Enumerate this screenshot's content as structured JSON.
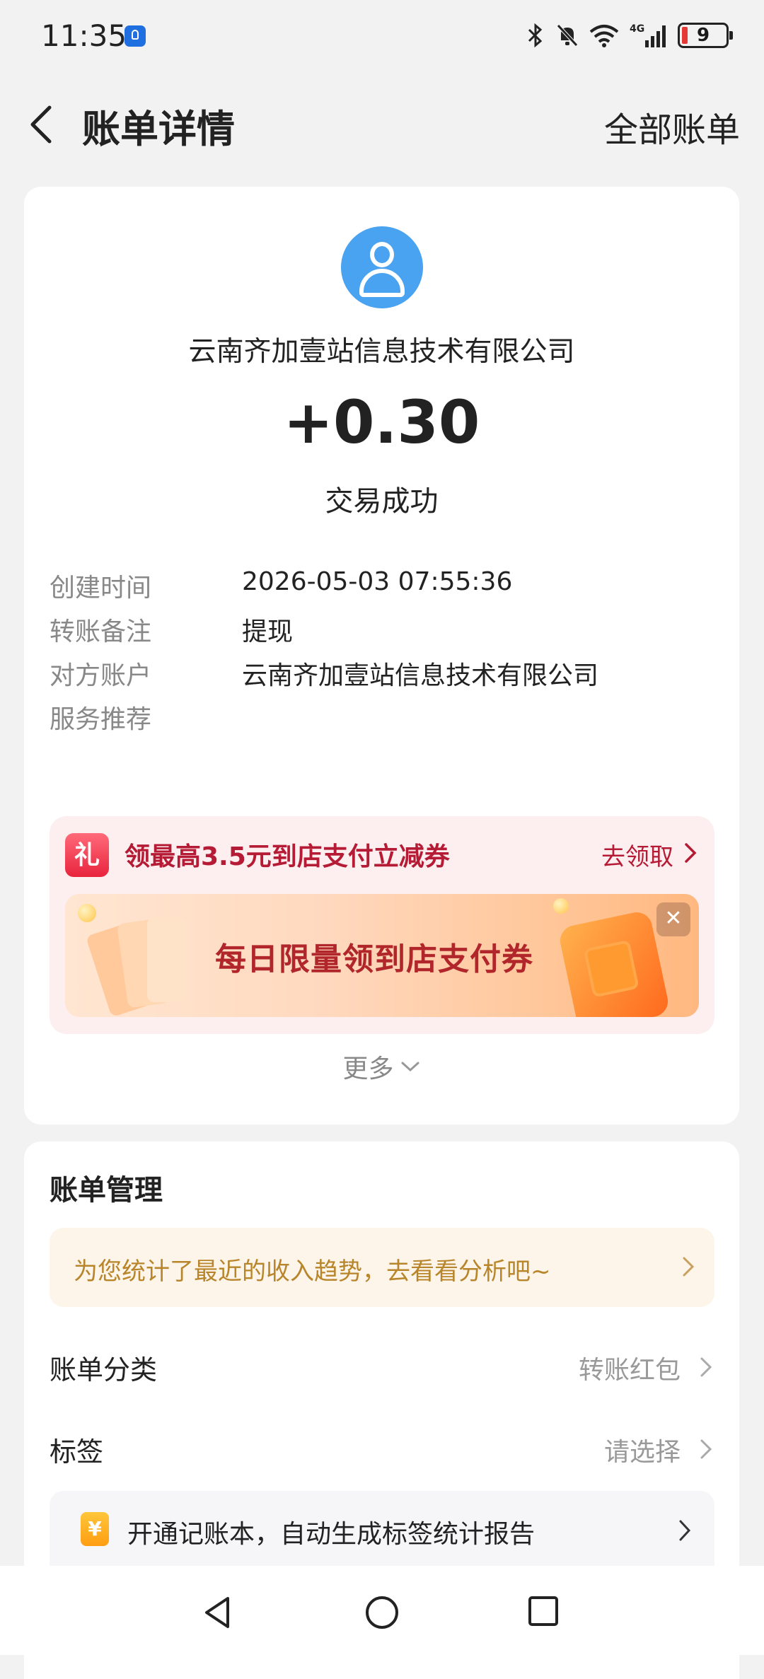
{
  "status_bar": {
    "time": "11:35",
    "battery": "9"
  },
  "nav": {
    "title": "账单详情",
    "right_link": "全部账单"
  },
  "transaction": {
    "payer": "云南齐加壹站信息技术有限公司",
    "amount": "+0.30",
    "status": "交易成功"
  },
  "details": [
    {
      "label": "创建时间",
      "value": "2026-05-03 07:55:36"
    },
    {
      "label": "转账备注",
      "value": "提现"
    },
    {
      "label": "对方账户",
      "value": "云南齐加壹站信息技术有限公司"
    },
    {
      "label": "服务推荐",
      "value": ""
    }
  ],
  "promo": {
    "icon_text": "礼",
    "title": "领最高3.5元到店支付立减券",
    "link": "去领取",
    "banner_text": "每日限量领到店支付券"
  },
  "more_label": "更多",
  "bill_management": {
    "title": "账单管理",
    "insight": "为您统计了最近的收入趋势，去看看分析吧~",
    "category": {
      "label": "账单分类",
      "value": "转账红包"
    },
    "tag": {
      "label": "标签",
      "value": "请选择"
    },
    "ledger": {
      "icon_text": "¥",
      "text": "开通记账本，自动生成标签统计报告"
    }
  },
  "colors": {
    "accent_blue": "#4aa3f0",
    "promo_red": "#b51b34",
    "insight_gold": "#b8852a"
  }
}
